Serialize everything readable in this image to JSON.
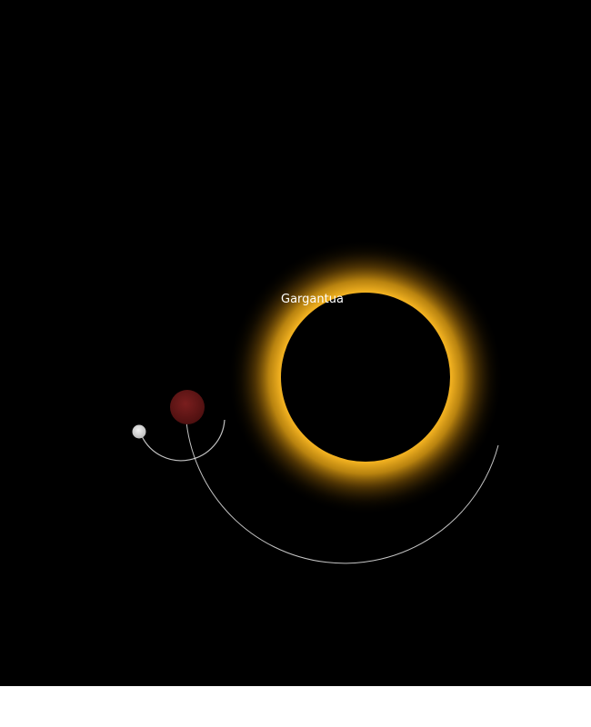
{
  "scene": {
    "background_color": "#000000",
    "page_color": "#ffffff",
    "black_hole": {
      "label": "Gargantua",
      "core_color": "#000000",
      "glow_color": "#f0b020"
    },
    "planet": {
      "color": "#6b1a1a"
    },
    "moon": {
      "color": "#d8d8d8"
    },
    "orbit_color": "#e6e6e6"
  }
}
